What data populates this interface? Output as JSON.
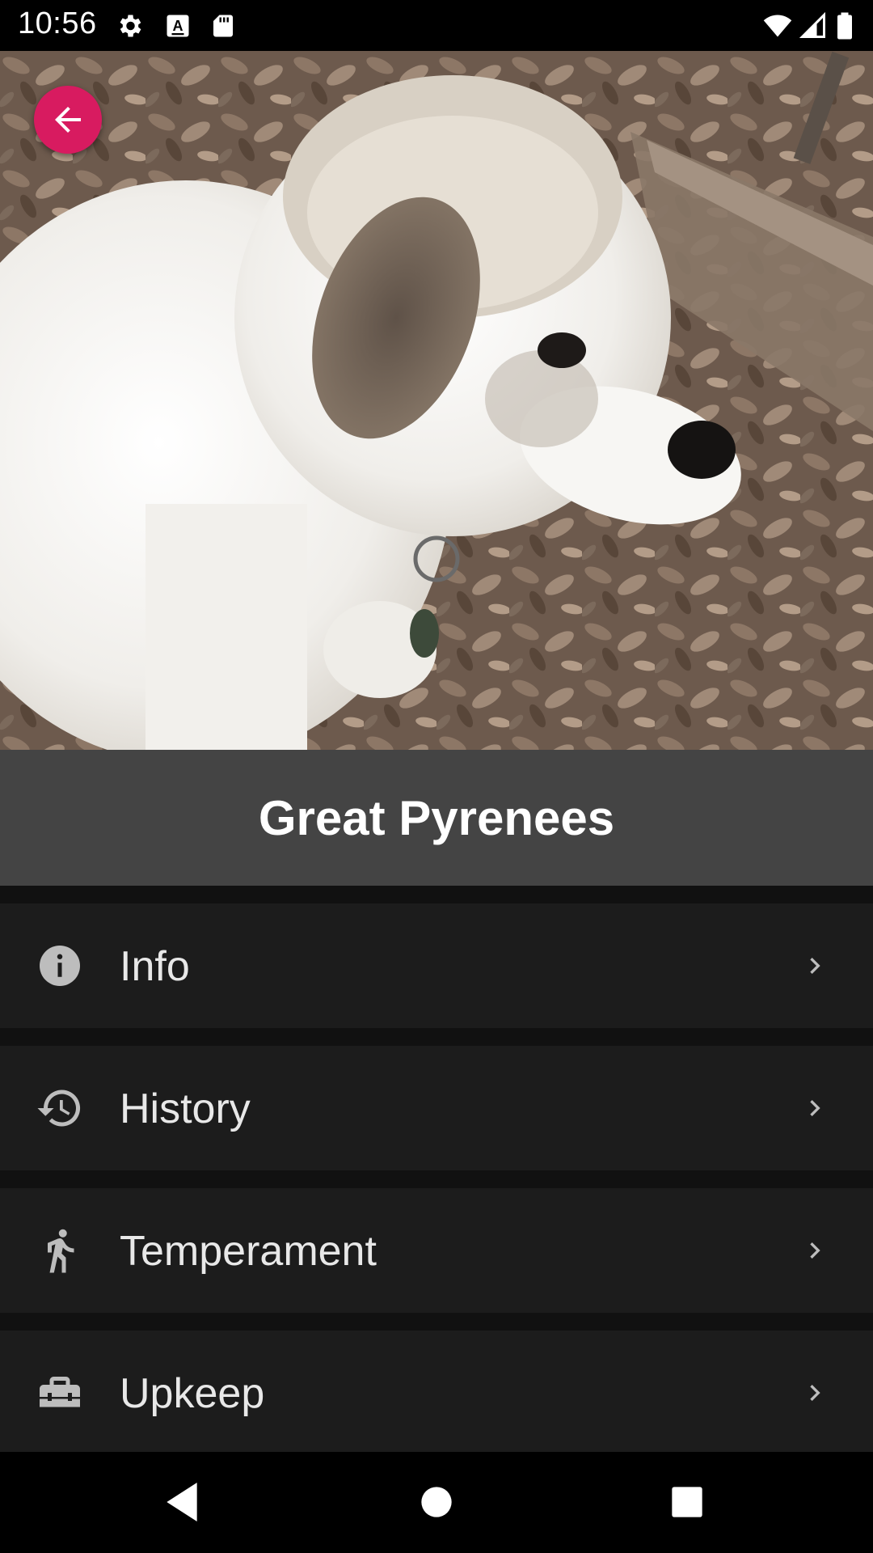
{
  "status_bar": {
    "time": "10:56",
    "left_icons": [
      "settings-icon",
      "keyboard-a-icon",
      "sd-card-icon"
    ],
    "right_icons": [
      "wifi-icon",
      "signal-icon",
      "battery-icon"
    ]
  },
  "hero": {
    "image_alt": "Great Pyrenees puppy standing on fallen leaves",
    "back_button_icon": "arrow-back-icon",
    "accent_color": "#d81b60"
  },
  "title": "Great Pyrenees",
  "sections": [
    {
      "label": "Info",
      "icon": "info-icon"
    },
    {
      "label": "History",
      "icon": "history-icon"
    },
    {
      "label": "Temperament",
      "icon": "running-person-icon"
    },
    {
      "label": "Upkeep",
      "icon": "toolbox-icon"
    }
  ],
  "nav_bar": {
    "buttons": [
      "back-triangle-icon",
      "home-circle-icon",
      "recents-square-icon"
    ]
  }
}
